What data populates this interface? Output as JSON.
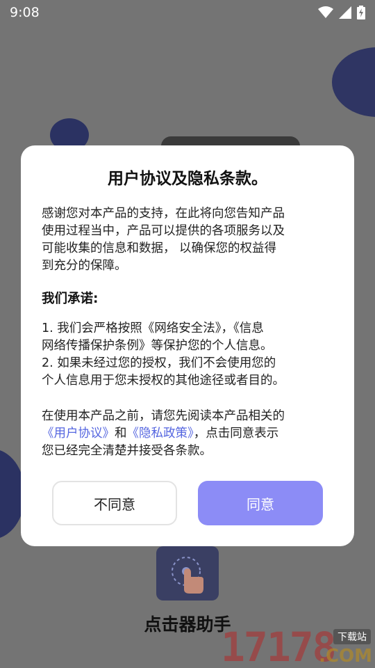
{
  "status_bar": {
    "time": "9:08",
    "icons": [
      "wifi-icon",
      "signal-icon",
      "battery-charging-icon"
    ]
  },
  "app": {
    "name": "点击器助手",
    "icon": "touch-hand-icon"
  },
  "dialog": {
    "title": "用户协议及隐私条款。",
    "intro_lines": [
      "感谢您对本产品的支持，在此将向您告知产品",
      "使用过程当中，产品可以提供的各项服务以及",
      "可能收集的信息和数据， 以确保您的权益得",
      "到充分的保障。"
    ],
    "promise_heading": "我们承诺:",
    "promise_items": [
      "1. 我们会严格按照《网络安全法》，《信息",
      "网络传播保护条例》等保护您的个人信息。",
      "2. 如果未经过您的授权，我们不会使用您的",
      "个人信息用于您未授权的其他途径或者目的。"
    ],
    "notice": {
      "line1": "在使用本产品之前，请您先阅读本产品相关的",
      "user_agreement_link": "《用户协议》",
      "and": "和",
      "privacy_policy_link": "《隐私政策》",
      "line2_tail": "，点击同意表示",
      "line3": "您已经完全清楚并接受各条款。"
    },
    "disagree_label": "不同意",
    "agree_label": "同意"
  },
  "watermark": {
    "digits": "17178",
    "badge": "下载站",
    "suffix": ".COM"
  },
  "colors": {
    "overlay": "#747474",
    "accent": "#8c8cf6",
    "link": "#5566e0",
    "decor": "#2b3262"
  }
}
